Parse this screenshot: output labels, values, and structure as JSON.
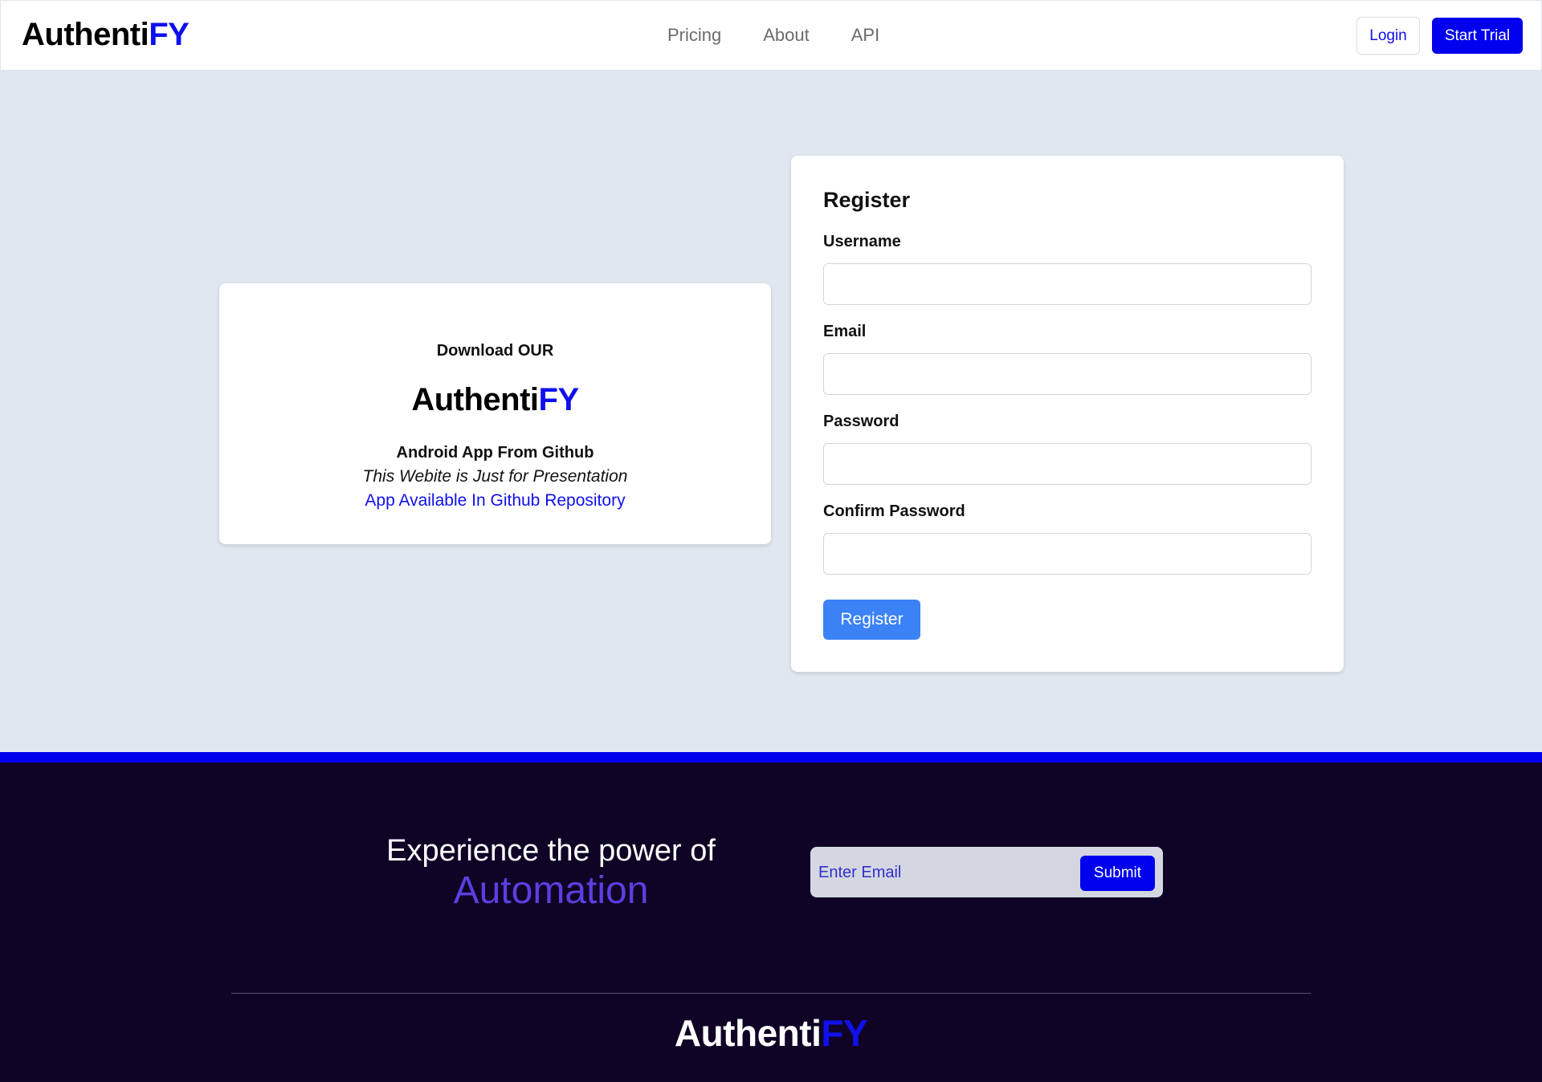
{
  "header": {
    "brand_main": "Authenti",
    "brand_accent": "FY",
    "nav": [
      {
        "label": "Pricing"
      },
      {
        "label": "About"
      },
      {
        "label": "API"
      }
    ],
    "login_label": "Login",
    "trial_label": "Start Trial"
  },
  "download_card": {
    "title": "Download OUR",
    "brand_main": "Authenti",
    "brand_accent": "FY",
    "subtitle": "Android App From Github",
    "note": "This Webite is Just for Presentation",
    "link_label": "App Available In Github Repository"
  },
  "register": {
    "title": "Register",
    "fields": [
      {
        "label": "Username",
        "value": ""
      },
      {
        "label": "Email",
        "value": ""
      },
      {
        "label": "Password",
        "value": ""
      },
      {
        "label": "Confirm Password",
        "value": ""
      }
    ],
    "button_label": "Register"
  },
  "footer": {
    "cta_line1": "Experience the power of",
    "cta_line2": "Automation",
    "email_placeholder": "Enter Email",
    "submit_label": "Submit",
    "brand_main": "Authenti",
    "brand_accent": "FY"
  },
  "colors": {
    "accent": "#0000ee",
    "page_bg": "#e1e7f0",
    "footer_bg": "#0f0426",
    "register_button": "#3b82f6",
    "automation_text": "#5b3fe0"
  }
}
